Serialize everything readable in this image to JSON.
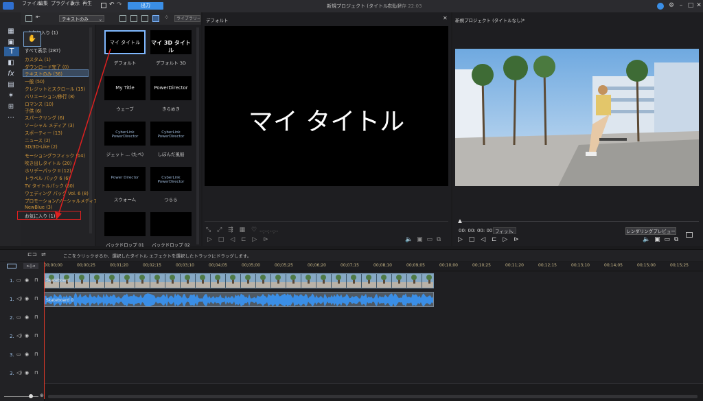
{
  "app": {
    "menu": [
      "ファイル",
      "編集",
      "プラグイン",
      "表示",
      "再生"
    ],
    "export_label": "出力",
    "window_title": "新規プロジェクト (タイトルなし)*",
    "autosave": "自動保存 22:03",
    "accent": "#3a8ee6"
  },
  "library": {
    "filter": "テキストのみ",
    "search_placeholder": "ライブラリーの検索",
    "categories": [
      {
        "label": "お気に入り (1)",
        "white": true
      },
      {
        "label": "すべて表示 (287)",
        "white": true
      },
      {
        "label": "カスタム (1)"
      },
      {
        "label": "ダウンロード完了 (0)"
      },
      {
        "label": "テキストのみ (36)",
        "selected": true
      },
      {
        "label": "一般 (50)"
      },
      {
        "label": "クレジットとスクロール (15)"
      },
      {
        "label": "バリエーション/移行 (8)"
      },
      {
        "label": "ロマンス (10)"
      },
      {
        "label": "子供 (6)"
      },
      {
        "label": "スパークリング (6)"
      },
      {
        "label": "ソーシャル メディア (3)"
      },
      {
        "label": "スポーティー (13)"
      },
      {
        "label": "ニュース (2)"
      },
      {
        "label": "3D/3D-Like (2)"
      },
      {
        "label": "モーショングラフィック (14)"
      },
      {
        "label": "吹き出しタイトル (20)"
      },
      {
        "label": "ホリデーパック II (12)"
      },
      {
        "label": "トラベル パック 6 (6)"
      },
      {
        "label": "TV タイトルパック (60)"
      },
      {
        "label": "ウェディング パック Vol. 6 (8)"
      },
      {
        "label": "プロモーション/ソーシャルメディア パック (12)"
      },
      {
        "label": "NewBlue (3)"
      },
      {
        "label": "お気に入り (1)",
        "white": true
      }
    ],
    "thumbnails": [
      {
        "preview": "マイ タイトル",
        "caption": "デフォルト"
      },
      {
        "preview": "マイ 3D タイトル",
        "caption": "デフォルト 3D"
      },
      {
        "preview": "My Title",
        "caption": "ウェーブ"
      },
      {
        "preview": "PowerDirector",
        "caption": "きらめき"
      },
      {
        "preview": "CyberLink PowerDirector",
        "caption": "ジェット ... (たぺ)"
      },
      {
        "preview": "CyberLink PowerDirector",
        "caption": "しぼんだ風船"
      },
      {
        "preview": "Power Director",
        "caption": "スウォーム"
      },
      {
        "preview": "CyberLink PowerDirector",
        "caption": "つらら"
      },
      {
        "preview": "",
        "caption": "バックドロップ 01"
      },
      {
        "preview": "",
        "caption": "バックドロップ 02"
      }
    ]
  },
  "preview_left": {
    "title": "デフォルト",
    "text": "マイ タイトル",
    "timecode": "--;--;--;--"
  },
  "preview_right": {
    "title": "新規プロジェクト (タイトルなし)*",
    "timecode": "00: 00: 00: 00",
    "fit": "フィット",
    "render_label": "レンダリングプレビュー"
  },
  "timeline": {
    "hint": "ここをクリックするか、選択したタイトル エフェクトを選択したトラックにドラッグします。",
    "ticks": [
      "00;00;00",
      "00;00;25",
      "00;01;20",
      "00;02;15",
      "00;03;10",
      "00;04;05",
      "00;05;00",
      "00;05;25",
      "00;06;20",
      "00;07;15",
      "00;08;10",
      "00;09;05",
      "00;10;00",
      "00;10;25",
      "00;11;20",
      "00;12;15",
      "00;13;10",
      "00;14;05",
      "00;15;00",
      "00;15;25"
    ],
    "tracks": [
      {
        "label": "1.",
        "type": "video"
      },
      {
        "label": "1.",
        "type": "audio"
      },
      {
        "label": "2.",
        "type": "video"
      },
      {
        "label": "2.",
        "type": "audio"
      },
      {
        "label": "3.",
        "type": "video"
      },
      {
        "label": "3.",
        "type": "audio"
      }
    ],
    "video_clip_label": "Skateboard",
    "audio_clip_label": "Skateboard 0"
  }
}
